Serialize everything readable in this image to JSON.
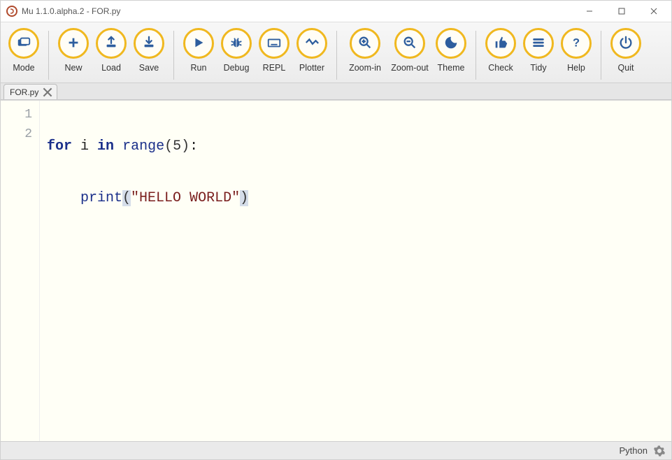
{
  "window": {
    "title": "Mu 1.1.0.alpha.2 - FOR.py"
  },
  "toolbar": {
    "mode": "Mode",
    "new": "New",
    "load": "Load",
    "save": "Save",
    "run": "Run",
    "debug": "Debug",
    "repl": "REPL",
    "plotter": "Plotter",
    "zoom_in": "Zoom-in",
    "zoom_out": "Zoom-out",
    "theme": "Theme",
    "check": "Check",
    "tidy": "Tidy",
    "help": "Help",
    "quit": "Quit"
  },
  "tabs": {
    "active": "FOR.py"
  },
  "editor": {
    "line_numbers": [
      "1",
      "2"
    ],
    "line1": {
      "kw_for": "for",
      "ident": " i ",
      "kw_in": "in",
      "space": " ",
      "fn": "range",
      "lp": "(",
      "arg": "5",
      "rp": ")",
      "colon": ":"
    },
    "line2": {
      "indent": "    ",
      "fn": "print",
      "lp": "(",
      "str": "\"HELLO WORLD\"",
      "rp": ")"
    }
  },
  "status": {
    "language": "Python"
  }
}
